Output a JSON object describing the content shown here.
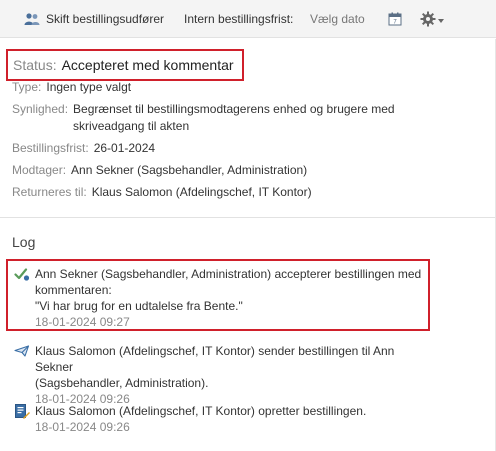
{
  "toolbar": {
    "change_label": "Skift bestillingsudfører",
    "deadline_label": "Intern bestillingsfrist:",
    "date_placeholder": "Vælg dato"
  },
  "details": {
    "status_label": "Status:",
    "status_value": "Accepteret med kommentar",
    "type_label": "Type:",
    "type_value": "Ingen type valgt",
    "visibility_label": "Synlighed:",
    "visibility_value": "Begrænset til bestillingsmodtagerens enhed og brugere med skriveadgang til akten",
    "deadline_label": "Bestillingsfrist:",
    "deadline_value": "26-01-2024",
    "recipient_label": "Modtager:",
    "recipient_value": "Ann Sekner (Sagsbehandler, Administration)",
    "return_label": "Returneres til:",
    "return_value": "Klaus Salomon (Afdelingschef, IT Kontor)"
  },
  "log": {
    "title": "Log",
    "entries": [
      {
        "icon": "accept-check-icon",
        "line1": "Ann Sekner (Sagsbehandler, Administration) accepterer bestillingen med",
        "line2": "kommentaren:",
        "line3": "\"Vi har brug for en udtalelse fra Bente.\"",
        "time": "18-01-2024 09:27"
      },
      {
        "icon": "send-icon",
        "line1": "Klaus Salomon (Afdelingschef, IT Kontor) sender bestillingen til Ann Sekner",
        "line2": "(Sagsbehandler, Administration).",
        "time": "18-01-2024 09:26"
      },
      {
        "icon": "create-document-icon",
        "line1": "Klaus Salomon (Afdelingschef, IT Kontor) opretter bestillingen.",
        "time": "18-01-2024 09:26"
      }
    ]
  },
  "colors": {
    "highlight": "#d0202b",
    "icon_blue": "#3a6ea5",
    "icon_green": "#5a9b5a"
  }
}
